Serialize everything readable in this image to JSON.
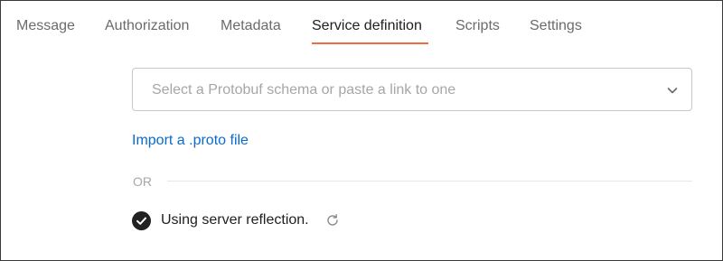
{
  "tabs": [
    {
      "label": "Message",
      "active": false
    },
    {
      "label": "Authorization",
      "active": false
    },
    {
      "label": "Metadata",
      "active": false
    },
    {
      "label": "Service definition",
      "active": true
    },
    {
      "label": "Scripts",
      "active": false
    },
    {
      "label": "Settings",
      "active": false
    }
  ],
  "schema_select": {
    "placeholder": "Select a Protobuf schema or paste a link to one",
    "icon": "chevron-down-icon"
  },
  "import_link": "Import a .proto file",
  "divider_label": "OR",
  "reflection": {
    "label": "Using server reflection.",
    "checked": true,
    "status_icon": "check-circle-icon",
    "action_icon": "refresh-icon"
  },
  "colors": {
    "accent_tab_underline": "#f26b3a",
    "link": "#0b6bcb",
    "text": "#212121",
    "muted_text": "#6b6b6b",
    "placeholder": "#a6a6a6"
  }
}
